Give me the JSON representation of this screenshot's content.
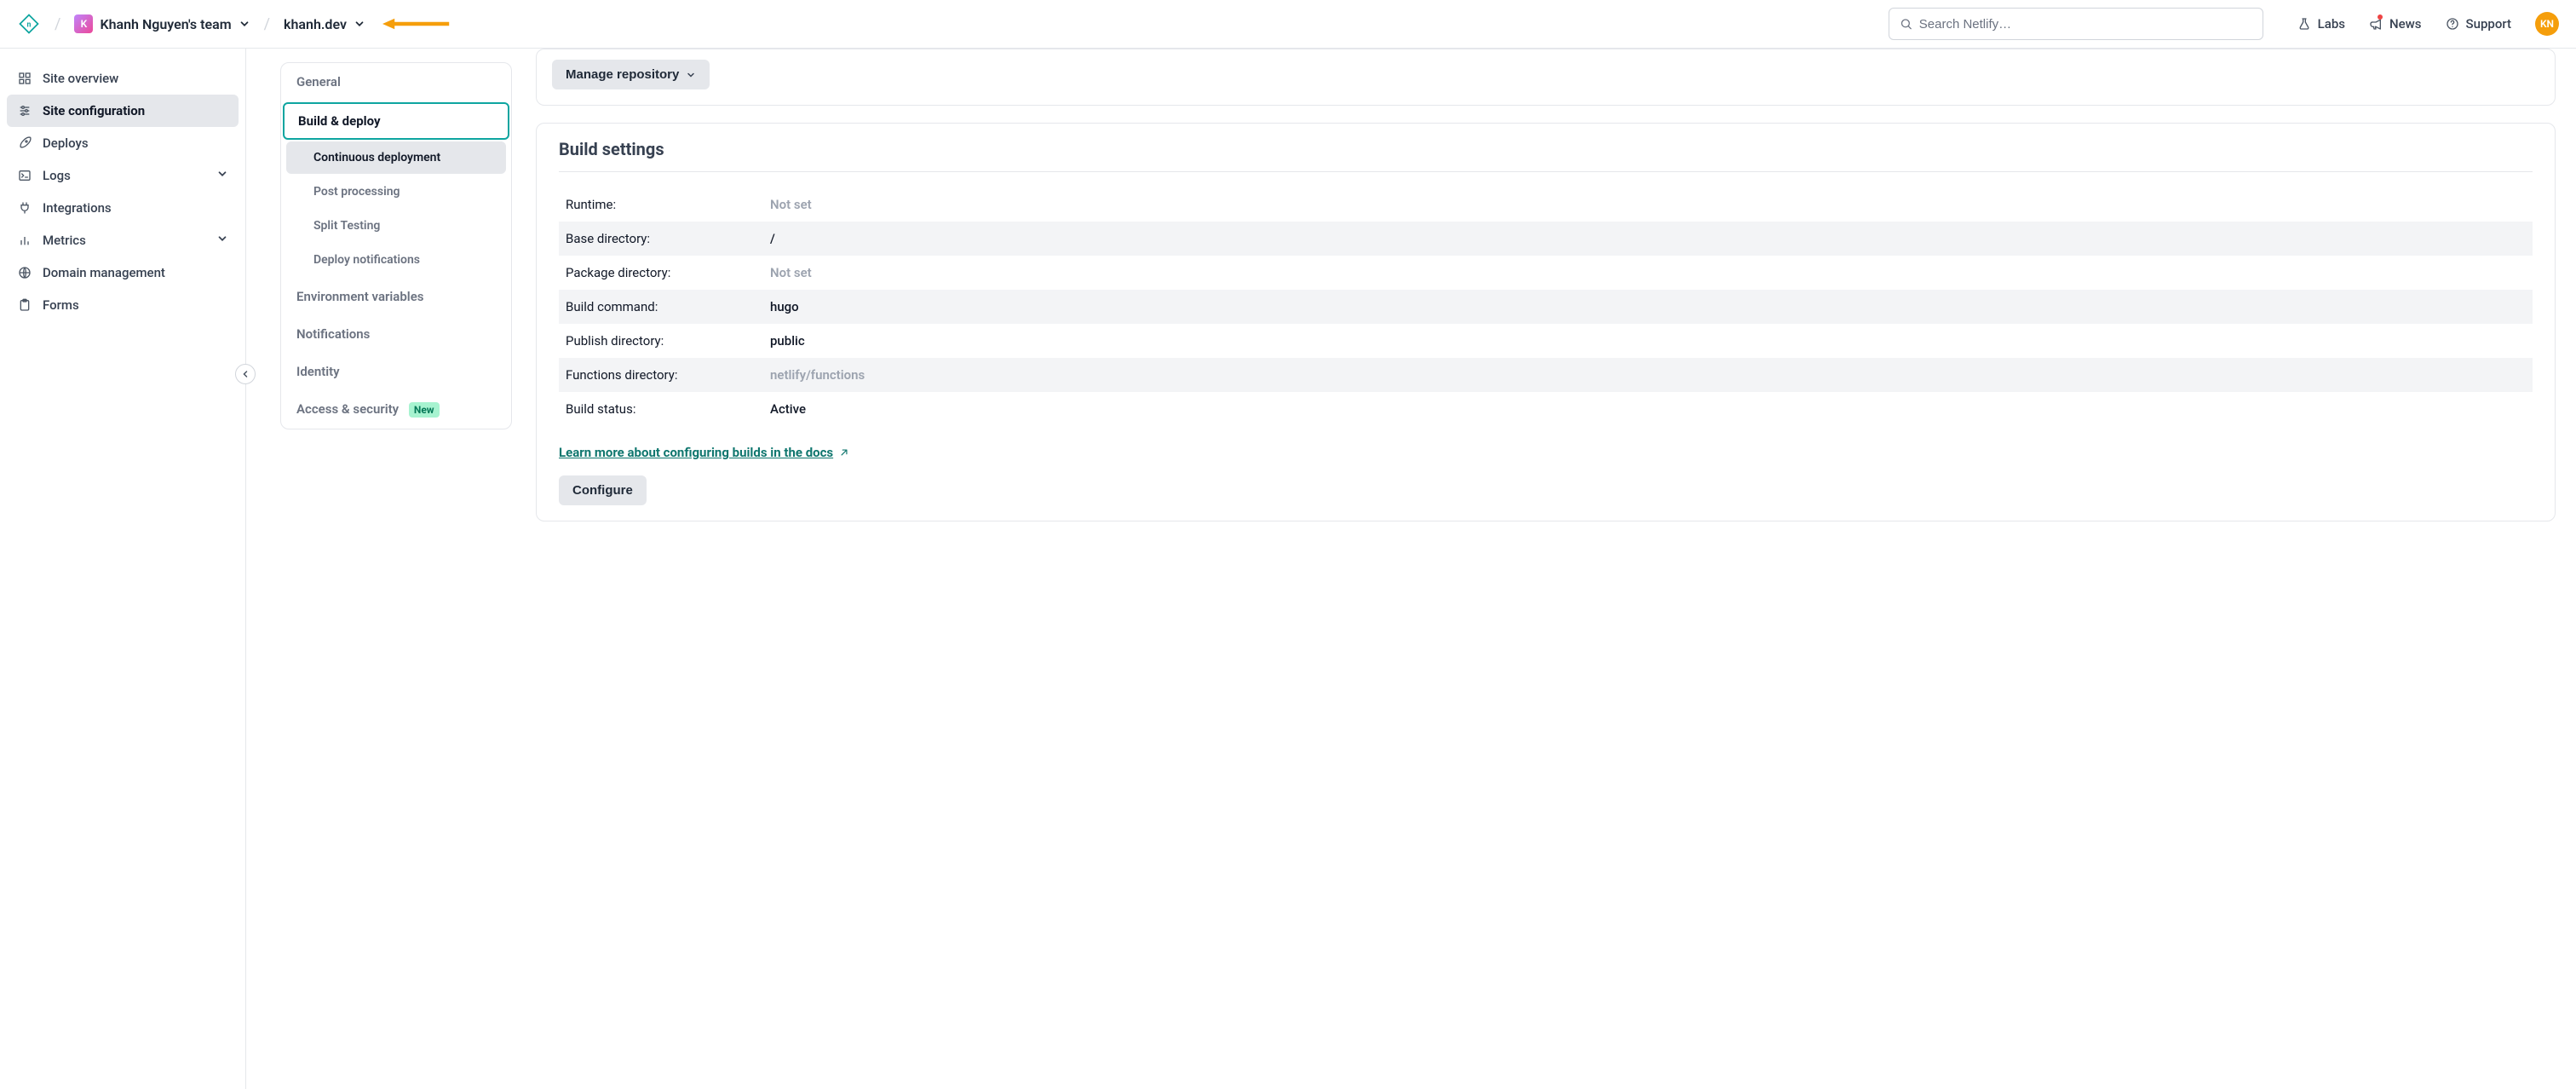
{
  "breadcrumb": {
    "team_initial": "K",
    "team_name": "Khanh Nguyen's team",
    "site_name": "khanh.dev"
  },
  "search": {
    "placeholder": "Search Netlify…"
  },
  "top_links": {
    "labs": "Labs",
    "news": "News",
    "support": "Support"
  },
  "avatar_initials": "KN",
  "sidebar": {
    "items": [
      "Site overview",
      "Site configuration",
      "Deploys",
      "Logs",
      "Integrations",
      "Metrics",
      "Domain management",
      "Forms"
    ]
  },
  "secnav": {
    "general": "General",
    "build_deploy": "Build & deploy",
    "subs": [
      "Continuous deployment",
      "Post processing",
      "Split Testing",
      "Deploy notifications"
    ],
    "env_vars": "Environment variables",
    "notifications": "Notifications",
    "identity": "Identity",
    "access_security": "Access & security",
    "new_badge": "New"
  },
  "panels": {
    "manage_repo": "Manage repository",
    "build_settings_title": "Build settings",
    "rows": [
      {
        "key": "Runtime:",
        "val": "Not set",
        "muted": true
      },
      {
        "key": "Base directory:",
        "val": "/",
        "muted": false
      },
      {
        "key": "Package directory:",
        "val": "Not set",
        "muted": true
      },
      {
        "key": "Build command:",
        "val": "hugo",
        "muted": false
      },
      {
        "key": "Publish directory:",
        "val": "public",
        "muted": false
      },
      {
        "key": "Functions directory:",
        "val": "netlify/functions",
        "muted": true
      },
      {
        "key": "Build status:",
        "val": "Active",
        "muted": false
      }
    ],
    "docs_link": "Learn more about configuring builds in the docs",
    "configure": "Configure"
  }
}
